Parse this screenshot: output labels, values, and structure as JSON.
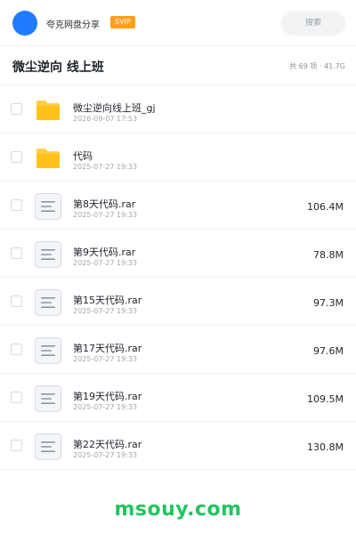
{
  "header": {
    "brand": "夸克网盘分享",
    "badge": "SVIP",
    "search_placeholder": "搜索"
  },
  "folder": {
    "title": "微尘逆向 线上班",
    "stats": "共 69 项 · 41.7G"
  },
  "files": [
    {
      "type": "folder",
      "name": "微尘逆向线上班_gj",
      "date": "2026-09-07 17:53",
      "size": ""
    },
    {
      "type": "folder",
      "name": "代码",
      "date": "2025-07-27 19:33",
      "size": ""
    },
    {
      "type": "file",
      "name": "第8天代码.rar",
      "date": "2025-07-27 19:33",
      "size": "106.4M"
    },
    {
      "type": "file",
      "name": "第9天代码.rar",
      "date": "2025-07-27 19:33",
      "size": "78.8M"
    },
    {
      "type": "file",
      "name": "第15天代码.rar",
      "date": "2025-07-27 19:33",
      "size": "97.3M"
    },
    {
      "type": "file",
      "name": "第17天代码.rar",
      "date": "2025-07-27 19:33",
      "size": "97.6M"
    },
    {
      "type": "file",
      "name": "第19天代码.rar",
      "date": "2025-07-27 19:33",
      "size": "109.5M"
    },
    {
      "type": "file",
      "name": "第22天代码.rar",
      "date": "2025-07-27 19:33",
      "size": "130.8M"
    }
  ],
  "watermark": "msouy.com",
  "colors": {
    "accent_blue": "#1f7bff",
    "svip_orange": "#ff9f1c",
    "folder_yellow": "#ffc833",
    "watermark_green": "#22c55e"
  }
}
